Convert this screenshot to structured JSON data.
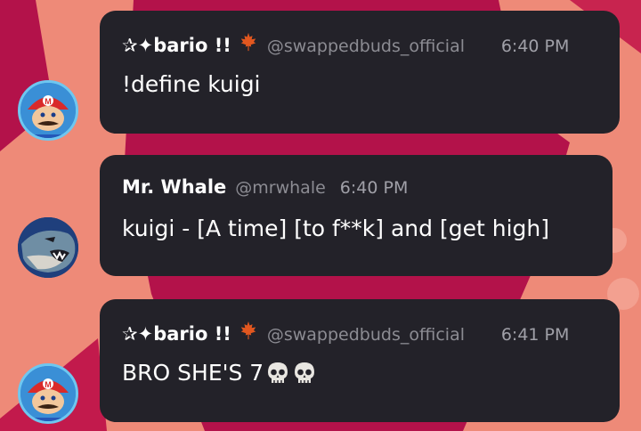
{
  "messages": [
    {
      "display_name": "✰✦bario !!",
      "badge_icon": "maple-leaf-icon",
      "handle": "@swappedbuds_official",
      "time": "6:40 PM",
      "text": "!define kuigi",
      "avatar": "mario-avatar"
    },
    {
      "display_name": "Mr. Whale",
      "handle": "@mrwhale",
      "time": "6:40 PM",
      "text": "kuigi - [A time] [to f**k] and [get high]",
      "avatar": "whale-avatar"
    },
    {
      "display_name": "✰✦bario !!",
      "badge_icon": "maple-leaf-icon",
      "handle": "@swappedbuds_official",
      "time": "6:41 PM",
      "text": "BRO SHE'S 7",
      "text_emoji": [
        "skull-emoji",
        "skull-emoji"
      ],
      "avatar": "mario-avatar"
    }
  ],
  "colors": {
    "background": "#ee8a78",
    "background_accent": "#b3124a",
    "bubble": "#232229",
    "handle": "#8c8c93",
    "badge": "#e2571f"
  }
}
